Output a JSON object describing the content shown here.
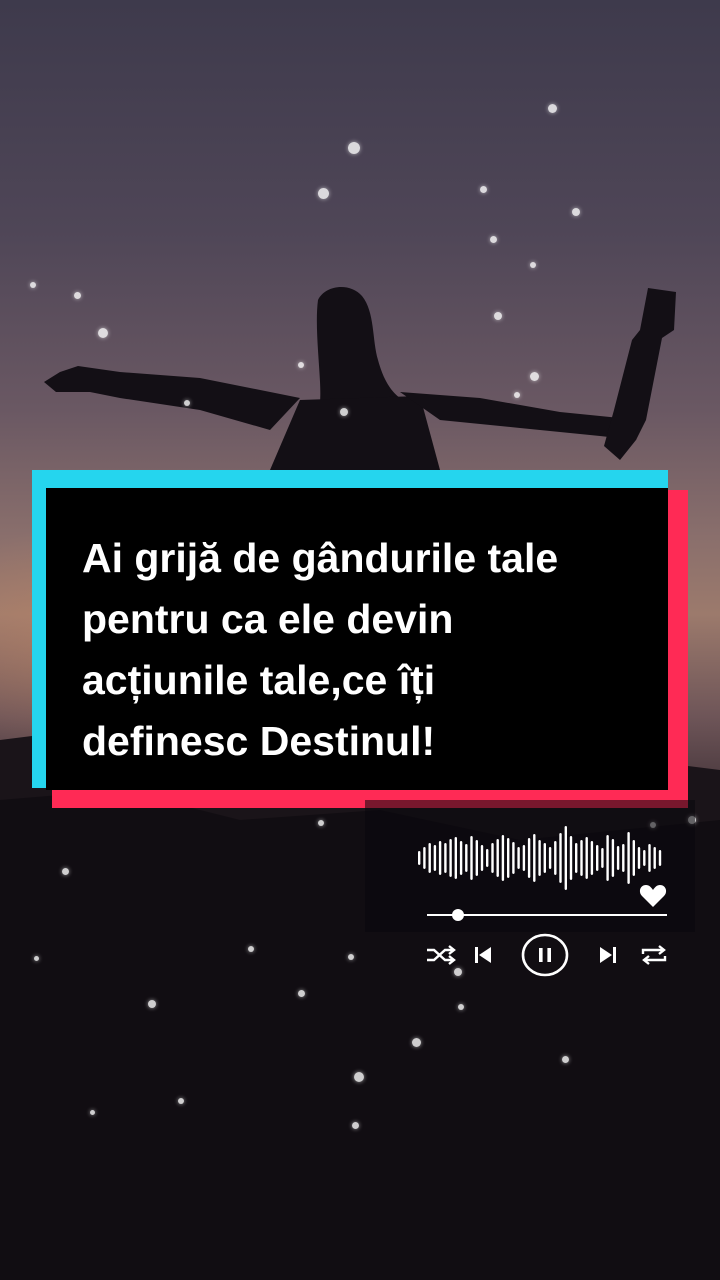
{
  "quote": {
    "lines": [
      "Ai grijă de gândurile tale",
      "pentru ca ele devin",
      "acțiunile tale,ce îți",
      "definesc Destinul!"
    ]
  },
  "player": {
    "progress": 0.13,
    "is_playing": true,
    "icons": {
      "like": "heart-icon",
      "shuffle": "shuffle-icon",
      "previous": "skip-previous-icon",
      "pause": "pause-icon",
      "next": "skip-next-icon",
      "repeat": "repeat-icon"
    }
  },
  "colors": {
    "accent_cyan": "#25d5ee",
    "accent_red": "#ff2a55",
    "card_background": "#000000",
    "text": "#ffffff"
  }
}
